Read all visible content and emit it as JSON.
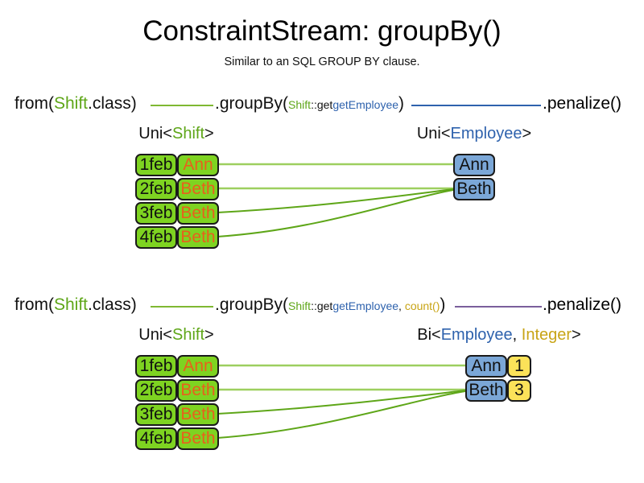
{
  "header": {
    "title": "ConstraintStream: groupBy()",
    "subtitle": "Similar to an SQL GROUP BY clause."
  },
  "colors": {
    "green": "#7ed321",
    "green_line": "#7fb832",
    "green_line_dark": "#5ea618",
    "blue": "#7ba7d7",
    "blue_line": "#2e62ad",
    "yellow": "#fbe259",
    "gold_text": "#c8a415",
    "purple_line": "#7a5f9c",
    "orange_text": "#e8601c",
    "border": "#1a1a1a"
  },
  "sections": [
    {
      "id": "section-1",
      "flow": {
        "from": {
          "prefix": "from(",
          "type": "Shift",
          "suffix": ".class)"
        },
        "group_by": {
          "prefix": ".groupBy(",
          "arg_type": "Shift",
          "arg_sep": "::",
          "arg_method": "getEmployee",
          "suffix": ")"
        },
        "penalize": ".penalize()",
        "connector_1_color": "#7fb832",
        "connector_2_color": "#2e62ad"
      },
      "source_caption": {
        "generic": "Uni<",
        "type": "Shift",
        "close": ">"
      },
      "result_caption": {
        "generic": "Uni<",
        "type": "Employee",
        "close": ">"
      },
      "source_rows": [
        {
          "date": "1feb",
          "name": "Ann"
        },
        {
          "date": "2feb",
          "name": "Beth"
        },
        {
          "date": "3feb",
          "name": "Beth"
        },
        {
          "date": "4feb",
          "name": "Beth"
        }
      ],
      "result_rows": [
        {
          "name": "Ann",
          "count": null
        },
        {
          "name": "Beth",
          "count": null
        }
      ],
      "links": [
        {
          "from_row": 0,
          "to_row": 0,
          "style": "light"
        },
        {
          "from_row": 1,
          "to_row": 1,
          "style": "light"
        },
        {
          "from_row": 2,
          "to_row": 1,
          "style": "dark"
        },
        {
          "from_row": 3,
          "to_row": 1,
          "style": "dark"
        }
      ]
    },
    {
      "id": "section-2",
      "flow": {
        "from": {
          "prefix": "from(",
          "type": "Shift",
          "suffix": ".class)"
        },
        "group_by": {
          "prefix": ".groupBy(",
          "arg_type": "Shift",
          "arg_sep": "::",
          "arg_method": "getEmployee",
          "arg_comma": ", ",
          "arg_collector": "count()",
          "suffix": ")"
        },
        "penalize": ".penalize()",
        "connector_1_color": "#7fb832",
        "connector_2_color": "#7a5f9c"
      },
      "source_caption": {
        "generic": "Uni<",
        "type": "Shift",
        "close": ">"
      },
      "result_caption": {
        "generic": "Bi<",
        "type": "Employee",
        "comma": ", ",
        "type2": "Integer",
        "close": ">"
      },
      "source_rows": [
        {
          "date": "1feb",
          "name": "Ann"
        },
        {
          "date": "2feb",
          "name": "Beth"
        },
        {
          "date": "3feb",
          "name": "Beth"
        },
        {
          "date": "4feb",
          "name": "Beth"
        }
      ],
      "result_rows": [
        {
          "name": "Ann",
          "count": "1"
        },
        {
          "name": "Beth",
          "count": "3"
        }
      ],
      "links": [
        {
          "from_row": 0,
          "to_row": 0,
          "style": "light"
        },
        {
          "from_row": 1,
          "to_row": 1,
          "style": "light"
        },
        {
          "from_row": 2,
          "to_row": 1,
          "style": "dark"
        },
        {
          "from_row": 3,
          "to_row": 1,
          "style": "dark"
        }
      ]
    }
  ]
}
